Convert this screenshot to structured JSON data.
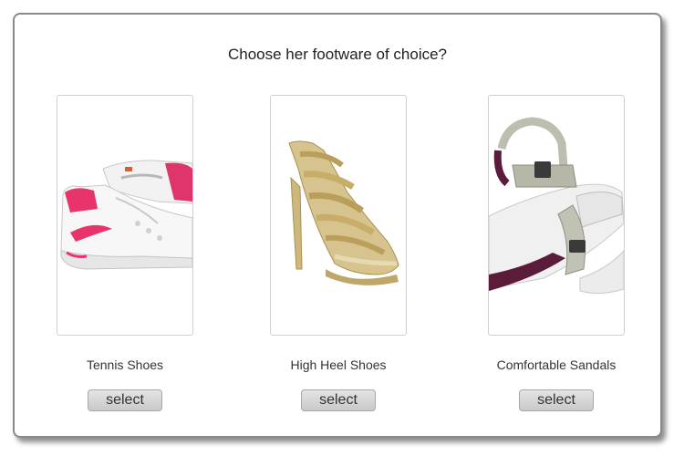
{
  "title": "Choose her footware of choice?",
  "options": [
    {
      "label": "Tennis Shoes",
      "button": "select"
    },
    {
      "label": "High Heel Shoes",
      "button": "select"
    },
    {
      "label": "Comfortable Sandals",
      "button": "select"
    }
  ],
  "colors": {
    "button_bg": "#d5d5d5",
    "card_border": "#8a8a8a",
    "text": "#333333"
  }
}
